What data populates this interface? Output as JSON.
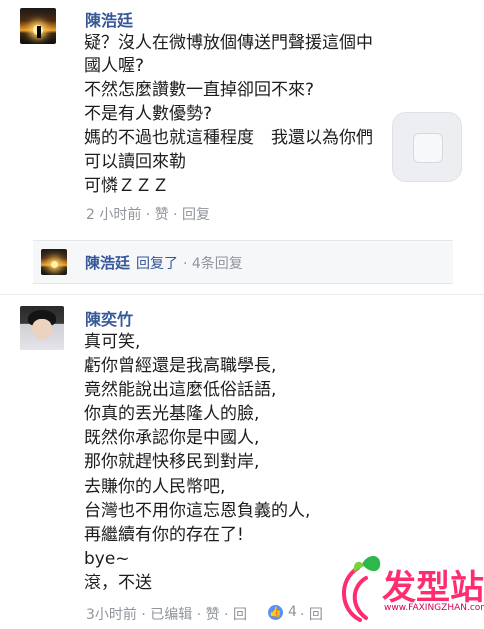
{
  "comment1": {
    "author": "陳浩廷",
    "lines": [
      "疑？沒人在微博放個傳送門聲援這個中",
      "國人喔?",
      "不然怎麼讚數一直掉卻回不來?",
      "不是有人數優勢?",
      "媽的不過也就這種程度　我還以為你們",
      "可以讀回來勒",
      "可憐ＺＺＺ"
    ],
    "meta": "2 小时前 · 赞 · 回复"
  },
  "reply_summary": {
    "author": "陳浩廷",
    "action": "回复了",
    "count_text": " · 4条回复"
  },
  "comment2": {
    "author": "陳奕竹",
    "lines": [
      "真可笑,",
      "虧你曾經還是我高職學長,",
      "竟然能說出這麼低俗話語,",
      "你真的丟光基隆人的臉,",
      "既然你承認你是中國人,",
      "那你就趕快移民到對岸,",
      "去賺你的人民幣吧,",
      "台灣也不用你這忘恩負義的人,",
      "再繼續有你的存在了!",
      "bye~",
      "滾，不送"
    ],
    "meta_time": "3小时前 · 已编辑 · 赞 · 回",
    "like_count": "4",
    "meta_tail": "· 回"
  },
  "watermark": {
    "brand": "发型站",
    "url": "www.FAXINGZHAN.com"
  },
  "colors": {
    "name": "#365899",
    "meta": "#90949c",
    "like_badge": "#5890ff",
    "watermark": "#ff2d6f"
  }
}
